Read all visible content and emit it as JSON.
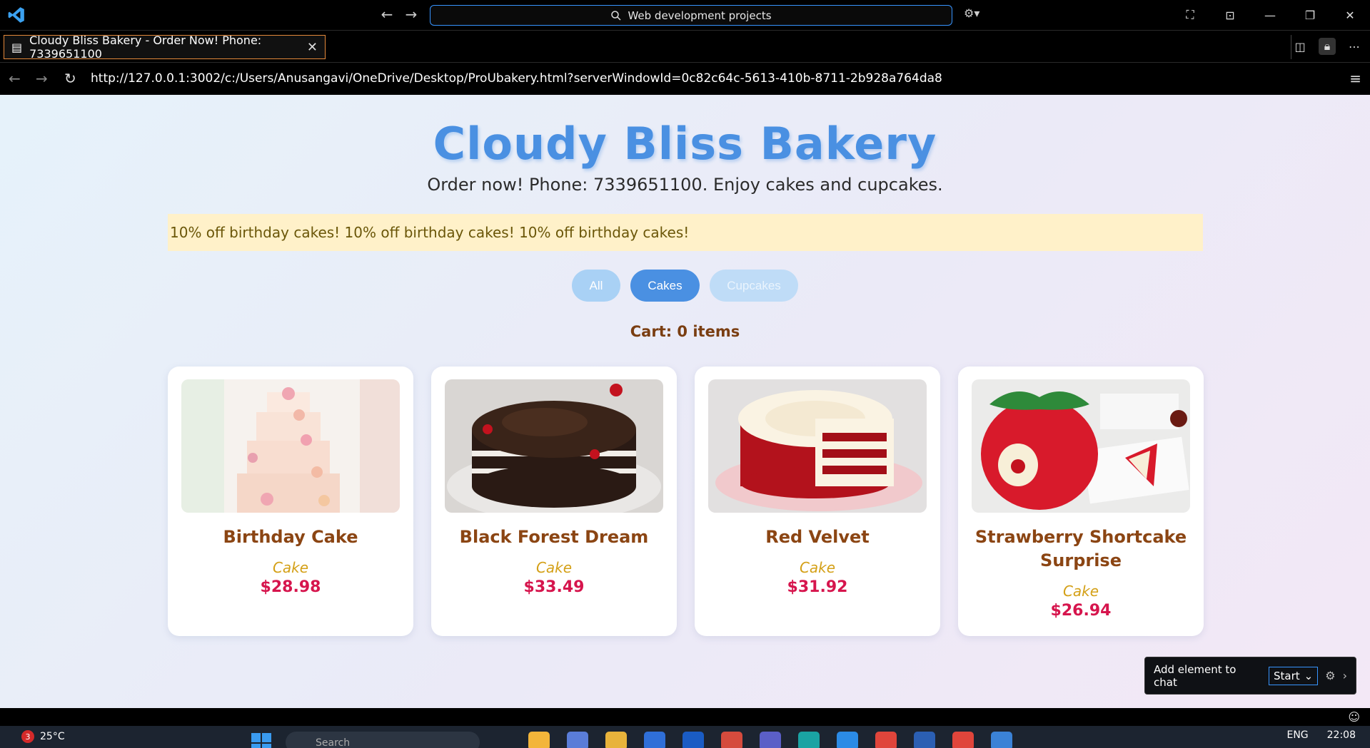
{
  "window": {
    "command_center": "Web development projects",
    "tab_title": "Cloudy Bliss Bakery - Order Now! Phone: 7339651100",
    "url": "http://127.0.0.1:3002/c:/Users/Anusangavi/OneDrive/Desktop/ProUbakery.html?serverWindowId=0c82c64c-5613-410b-8711-2b928a764da8"
  },
  "page": {
    "title": "Cloudy Bliss Bakery",
    "subtitle": "Order now! Phone: 7339651100. Enjoy cakes and cupcakes.",
    "promo": "10% off birthday cakes! 10% off birthday cakes! 10% off birthday cakes!",
    "filters": [
      "All",
      "Cakes",
      "Cupcakes"
    ],
    "active_filter": "Cakes",
    "cart": "Cart: 0 items",
    "products": [
      {
        "name": "Birthday Cake",
        "category": "Cake",
        "price": "$28.98"
      },
      {
        "name": "Black Forest Dream",
        "category": "Cake",
        "price": "$33.49"
      },
      {
        "name": "Red Velvet",
        "category": "Cake",
        "price": "$31.92"
      },
      {
        "name": "Strawberry Shortcake Surprise",
        "category": "Cake",
        "price": "$26.94"
      }
    ]
  },
  "chat_widget": {
    "label": "Add element to chat",
    "mode": "Start"
  },
  "taskbar": {
    "weather_badge": "3",
    "temperature": "25°C",
    "search_placeholder": "Search",
    "language": "ENG",
    "time": "22:08"
  },
  "colors": {
    "accent": "#4a90e2",
    "promo_bg": "#fff1c9",
    "price": "#d6154d",
    "product_name": "#8b4513",
    "category": "#d4a017"
  }
}
